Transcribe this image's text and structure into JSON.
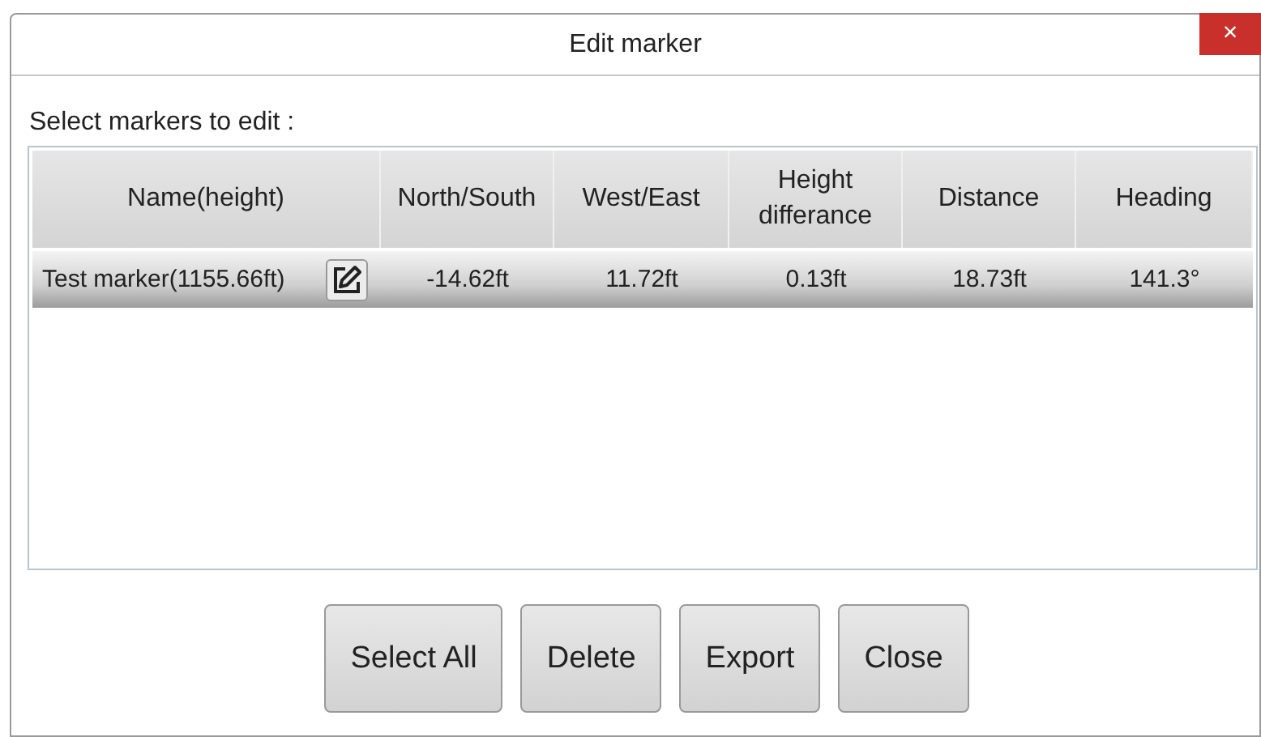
{
  "window": {
    "title": "Edit marker",
    "close": "×"
  },
  "prompt": "Select markers to edit :",
  "table": {
    "columns": [
      "Name(height)",
      "North/South",
      "West/East",
      "Height differance",
      "Distance",
      "Heading"
    ],
    "rows": [
      {
        "selected": true,
        "cells": [
          "Test marker(1155.66ft)",
          "-14.62ft",
          "11.72ft",
          "0.13ft",
          "18.73ft",
          "141.3°"
        ]
      }
    ]
  },
  "buttons": [
    "Select All",
    "Delete",
    "Export",
    "Close"
  ]
}
